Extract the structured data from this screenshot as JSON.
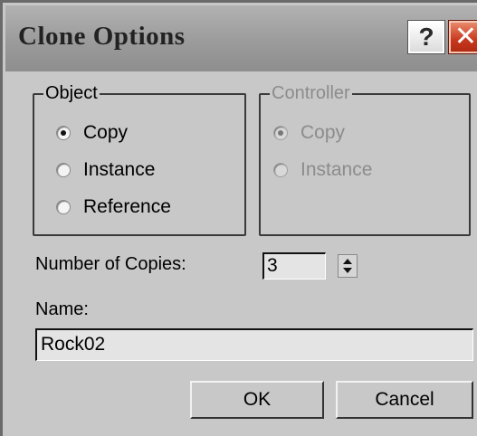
{
  "window": {
    "title": "Clone Options",
    "help_label": "?",
    "close_label": "✕"
  },
  "object_group": {
    "legend": "Object",
    "options": [
      {
        "label": "Copy",
        "selected": true
      },
      {
        "label": "Instance",
        "selected": false
      },
      {
        "label": "Reference",
        "selected": false
      }
    ]
  },
  "controller_group": {
    "legend": "Controller",
    "enabled": false,
    "options": [
      {
        "label": "Copy",
        "selected": true
      },
      {
        "label": "Instance",
        "selected": false
      }
    ]
  },
  "copies": {
    "label": "Number of Copies:",
    "value": "3"
  },
  "name": {
    "label": "Name:",
    "value": "Rock02"
  },
  "buttons": {
    "ok": "OK",
    "cancel": "Cancel"
  },
  "colors": {
    "dialog_bg": "#c8c8c8",
    "close_button": "#c8381e",
    "disabled_text": "#8c8c8c"
  }
}
